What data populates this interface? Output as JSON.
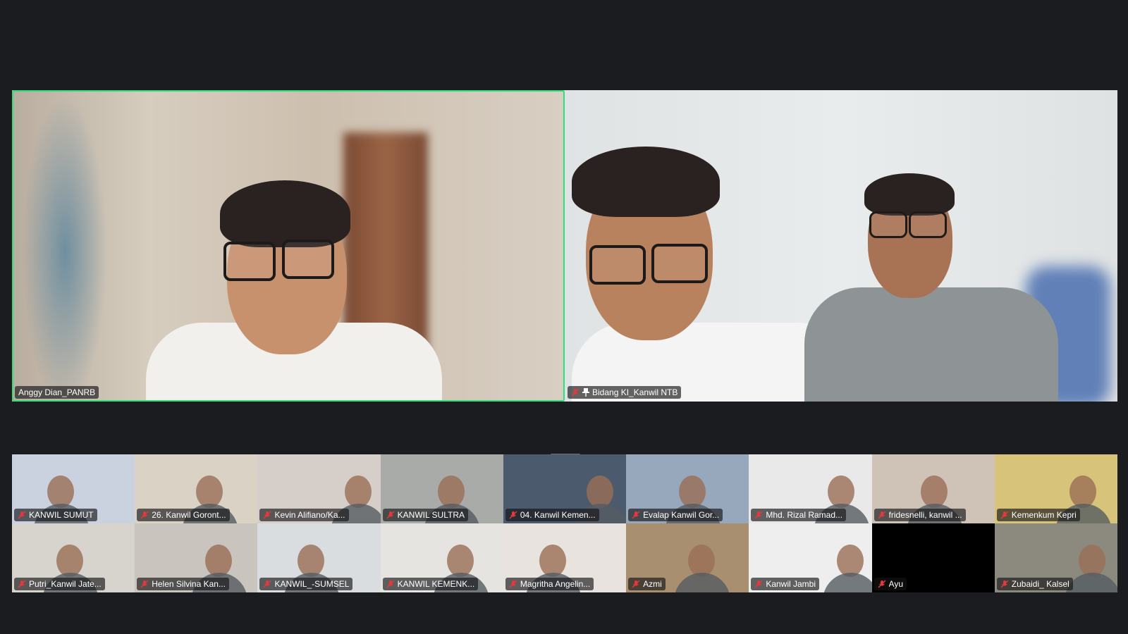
{
  "speakers": [
    {
      "name": "Anggy Dian_PANRB",
      "muted": false,
      "pinned": false,
      "active": true
    },
    {
      "name": "Bidang KI_Kanwil NTB",
      "muted": true,
      "pinned": true,
      "active": false
    }
  ],
  "gallery": [
    {
      "name": "KANWIL SUMUT",
      "bg": "#c9d2de"
    },
    {
      "name": "26. Kanwil Goront...",
      "bg": "#d9d2c5"
    },
    {
      "name": "Kevin Alifiano/Ka...",
      "bg": "#d6cfc9"
    },
    {
      "name": "KANWIL SULTRA",
      "bg": "#a9aba9"
    },
    {
      "name": "04. Kanwil Kemen...",
      "bg": "#4b5a6d"
    },
    {
      "name": "Evalap Kanwil Gor...",
      "bg": "#97a8bd"
    },
    {
      "name": "Mhd. Rizal Ramad...",
      "bg": "#e9e9ea"
    },
    {
      "name": "fridesnelli, kanwil ...",
      "bg": "#cfc3b8"
    },
    {
      "name": "Kemenkum Kepri",
      "bg": "#d8c37b"
    },
    {
      "name": "Putri_Kanwil Jate...",
      "bg": "#d7d4ce"
    },
    {
      "name": "Helen Silvina Kan...",
      "bg": "#c9c4bd"
    },
    {
      "name": "KANWIL_-SUMSEL",
      "bg": "#d9dde0"
    },
    {
      "name": "KANWIL KEMENK...",
      "bg": "#e6e4e1"
    },
    {
      "name": "Magritha Angelin...",
      "bg": "#e8e3de"
    },
    {
      "name": "Azmi",
      "bg": "#a88f6f"
    },
    {
      "name": "Kanwil Jambi",
      "bg": "#eeeeee"
    },
    {
      "name": "Ayu",
      "bg": "#000000"
    },
    {
      "name": "Zubaidi_ Kalsel",
      "bg": "#8c8a7e"
    }
  ],
  "colors": {
    "active_speaker_border": "#2ee07a",
    "muted_icon": "#e0393e",
    "background": "#1a1c1f"
  },
  "icons": {
    "muted": "microphone-muted-icon",
    "pinned": "pin-icon"
  }
}
